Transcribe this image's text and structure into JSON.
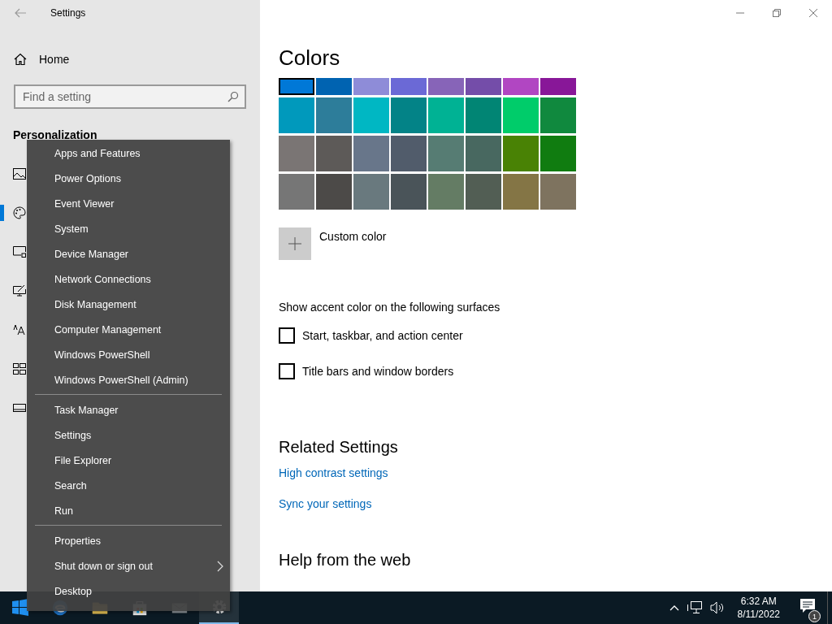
{
  "window": {
    "title": "Settings"
  },
  "sidebar": {
    "home": "Home",
    "search": {
      "placeholder": "Find a setting"
    },
    "section": "Personalization",
    "items": [
      {
        "selected": false
      },
      {
        "selected": true
      },
      {
        "selected": false
      },
      {
        "selected": false
      },
      {
        "selected": false
      },
      {
        "selected": false
      },
      {
        "selected": false
      }
    ]
  },
  "main": {
    "heading": "Colors",
    "swatches": [
      {
        "color": "#0078d7",
        "selected": true
      },
      {
        "color": "#0063b1",
        "selected": false
      },
      {
        "color": "#8e8cd8",
        "selected": false
      },
      {
        "color": "#6b69d6",
        "selected": false
      },
      {
        "color": "#8764b8",
        "selected": false
      },
      {
        "color": "#744da9",
        "selected": false
      },
      {
        "color": "#b146c2",
        "selected": false
      },
      {
        "color": "#881798",
        "selected": false
      },
      {
        "color": "#0099bc",
        "selected": false
      },
      {
        "color": "#2d7d9a",
        "selected": false
      },
      {
        "color": "#00b7c3",
        "selected": false
      },
      {
        "color": "#038387",
        "selected": false
      },
      {
        "color": "#00b294",
        "selected": false
      },
      {
        "color": "#018574",
        "selected": false
      },
      {
        "color": "#00cc6a",
        "selected": false
      },
      {
        "color": "#10893e",
        "selected": false
      },
      {
        "color": "#7a7574",
        "selected": false
      },
      {
        "color": "#5d5a58",
        "selected": false
      },
      {
        "color": "#68768a",
        "selected": false
      },
      {
        "color": "#515c6b",
        "selected": false
      },
      {
        "color": "#567c73",
        "selected": false
      },
      {
        "color": "#486860",
        "selected": false
      },
      {
        "color": "#498205",
        "selected": false
      },
      {
        "color": "#107c10",
        "selected": false
      },
      {
        "color": "#767676",
        "selected": false
      },
      {
        "color": "#4c4a48",
        "selected": false
      },
      {
        "color": "#69797e",
        "selected": false
      },
      {
        "color": "#4a5459",
        "selected": false
      },
      {
        "color": "#647c64",
        "selected": false
      },
      {
        "color": "#525e54",
        "selected": false
      },
      {
        "color": "#847545",
        "selected": false
      },
      {
        "color": "#7e735f",
        "selected": false
      }
    ],
    "custom_color": "Custom color",
    "surfaces_label": "Show accent color on the following surfaces",
    "checkboxes": [
      {
        "label": "Start, taskbar, and action center",
        "checked": false
      },
      {
        "label": "Title bars and window borders",
        "checked": false
      }
    ],
    "related_heading": "Related Settings",
    "related_links": [
      "High contrast settings",
      "Sync your settings"
    ],
    "help_heading": "Help from the web"
  },
  "context_menu": {
    "groups": [
      [
        {
          "label": "Apps and Features",
          "has_submenu": false
        },
        {
          "label": "Power Options",
          "has_submenu": false
        },
        {
          "label": "Event Viewer",
          "has_submenu": false
        },
        {
          "label": "System",
          "has_submenu": false
        },
        {
          "label": "Device Manager",
          "has_submenu": false
        },
        {
          "label": "Network Connections",
          "has_submenu": false
        },
        {
          "label": "Disk Management",
          "has_submenu": false
        },
        {
          "label": "Computer Management",
          "has_submenu": false
        },
        {
          "label": "Windows PowerShell",
          "has_submenu": false
        },
        {
          "label": "Windows PowerShell (Admin)",
          "has_submenu": false
        }
      ],
      [
        {
          "label": "Task Manager",
          "has_submenu": false
        },
        {
          "label": "Settings",
          "has_submenu": false
        },
        {
          "label": "File Explorer",
          "has_submenu": false
        },
        {
          "label": "Search",
          "has_submenu": false
        },
        {
          "label": "Run",
          "has_submenu": false
        }
      ],
      [
        {
          "label": "Properties",
          "has_submenu": false
        },
        {
          "label": "Shut down or sign out",
          "has_submenu": true
        },
        {
          "label": "Desktop",
          "has_submenu": false
        }
      ]
    ]
  },
  "taskbar": {
    "apps": [
      {
        "selected": false
      },
      {
        "selected": false
      },
      {
        "selected": false
      },
      {
        "selected": false
      },
      {
        "selected": false
      },
      {
        "selected": true
      }
    ],
    "time": "6:32 AM",
    "date": "8/11/2022",
    "notifications": "1"
  }
}
